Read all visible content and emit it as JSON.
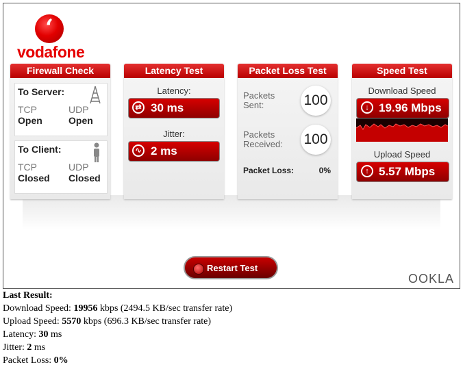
{
  "brand": {
    "name": "vodafone",
    "provider": "OOKLA"
  },
  "firewall": {
    "title": "Firewall Check",
    "to_server": {
      "label": "To Server:",
      "tcp_label": "TCP",
      "tcp_value": "Open",
      "udp_label": "UDP",
      "udp_value": "Open"
    },
    "to_client": {
      "label": "To Client:",
      "tcp_label": "TCP",
      "tcp_value": "Closed",
      "udp_label": "UDP",
      "udp_value": "Closed"
    }
  },
  "latency": {
    "title": "Latency Test",
    "latency_label": "Latency:",
    "latency_value": "30 ms",
    "jitter_label": "Jitter:",
    "jitter_value": "2 ms"
  },
  "packet": {
    "title": "Packet Loss Test",
    "sent_label": "Packets\nSent:",
    "sent_value": "100",
    "received_label": "Packets\nReceived:",
    "received_value": "100",
    "loss_label": "Packet Loss:",
    "loss_value": "0%"
  },
  "speed": {
    "title": "Speed Test",
    "download_label": "Download Speed",
    "download_value": "19.96 Mbps",
    "upload_label": "Upload Speed",
    "upload_value": "5.57 Mbps"
  },
  "restart_label": "Restart Test",
  "last_result": {
    "heading": "Last Result:",
    "download_prefix": "Download Speed: ",
    "download_kbps": "19956",
    "download_suffix": " kbps (2494.5 KB/sec transfer rate)",
    "upload_prefix": "Upload Speed: ",
    "upload_kbps": "5570",
    "upload_suffix": " kbps (696.3 KB/sec transfer rate)",
    "latency_prefix": "Latency: ",
    "latency_value": "30",
    "latency_suffix": " ms",
    "jitter_prefix": "Jitter: ",
    "jitter_value": "2",
    "jitter_suffix": " ms",
    "loss_prefix": "Packet Loss: ",
    "loss_value": "0%"
  },
  "colors": {
    "accent": "#e60000",
    "dark_red": "#8e0000"
  }
}
